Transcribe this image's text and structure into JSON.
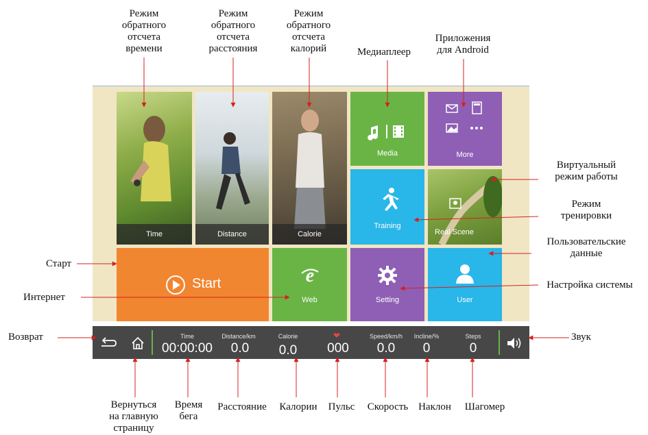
{
  "annotations": {
    "time_mode": "Режим\nобратного\nотсчета\nвремени",
    "distance_mode": "Режим\nобратного\nотсчета\nрасстояния",
    "calorie_mode": "Режим\nобратного\nотсчета\nкалорий",
    "media_player": "Медиаплеер",
    "android_apps": "Приложения\nдля Android",
    "virtual_mode": "Виртуальный\nрежим работы",
    "training_mode": "Режим\nтренировки",
    "user_data": "Пользовательские\nданные",
    "system_settings": "Настройка системы",
    "start": "Старт",
    "internet": "Интернет",
    "back": "Возврат",
    "sound": "Звук",
    "home": "Вернуться\nна главную\nстраницу",
    "run_time": "Время\nбега",
    "distance": "Расстояние",
    "calories": "Калории",
    "pulse": "Пульс",
    "speed": "Скорость",
    "incline": "Наклон",
    "pedometer": "Шагомер"
  },
  "tiles": {
    "time": "Time",
    "distance": "Distance",
    "calorie": "Calorie",
    "media": "Media",
    "more": "More",
    "training": "Training",
    "real_scene": "Real Scene",
    "start": "Start",
    "web": "Web",
    "setting": "Setting",
    "user": "User"
  },
  "status": {
    "time_label": "Time",
    "time_value": "00:00:00",
    "distance_label": "Distance/km",
    "distance_value": "0.0",
    "calorie_label": "Calorie",
    "calorie_value": "0.0",
    "heart_value": "000",
    "speed_label": "Speed/km/h",
    "speed_value": "0.0",
    "incline_label": "Incline/%",
    "incline_value": "0",
    "steps_label": "Steps",
    "steps_value": "0"
  },
  "icons": {
    "back": "back-arrow-icon",
    "home": "home-icon",
    "heart": "heart-icon",
    "volume": "volume-icon",
    "media": "music-film-icon",
    "more": "apps-grid-icon",
    "training": "running-person-icon",
    "real_scene": "map-pin-icon",
    "start": "play-circle-icon",
    "web": "browser-e-icon",
    "setting": "gear-icon",
    "user": "user-silhouette-icon"
  },
  "colors": {
    "green": "#6ab446",
    "purple": "#8e5fb4",
    "blue": "#29b6e8",
    "orange": "#f18631",
    "statusbar": "#474747",
    "screen_bg": "#f0e6c4",
    "arrow": "#d62020"
  }
}
